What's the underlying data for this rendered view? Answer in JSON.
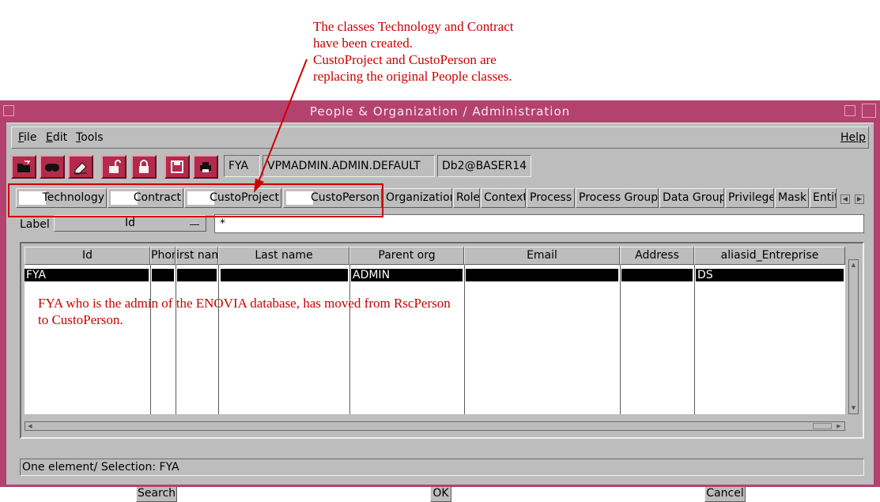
{
  "annotations": {
    "top_note": "The classes Technology and Contract\nhave been created.\nCustoProject and CustoPerson are\nreplacing the original People classes.",
    "bottom_note": "FYA who is the admin of the ENOVIA database, has moved from RscPerson\nto CustoPerson."
  },
  "window": {
    "title": "People & Organization / Administration"
  },
  "menu": {
    "file": "ile",
    "file_mn": "F",
    "edit": "dit",
    "edit_mn": "E",
    "tools": "ools",
    "tools_mn": "T",
    "help": "Help"
  },
  "toolbar": {
    "user": "FYA",
    "context": "VPMADMIN.ADMIN.DEFAULT",
    "database": "Db2@BASER14"
  },
  "tabs": {
    "technology": "Technology",
    "contract": "Contract",
    "custoproject": "CustoProject",
    "custoperson": "CustoPerson",
    "organization": "Organization",
    "role": "Role",
    "context": "Context",
    "process": "Process",
    "process_group": "Process Group",
    "data_group": "Data Group",
    "privilege": "Privilege",
    "mask": "Mask",
    "entity": "Entity"
  },
  "filter": {
    "label": "Label",
    "field": "Id",
    "value": "*"
  },
  "table": {
    "headers": {
      "id": "Id",
      "phone": "Phon",
      "first_name": "irst nam",
      "last_name": "Last name",
      "parent_org": "Parent org",
      "email": "Email",
      "address": "Address",
      "alias": "aliasid_Entreprise"
    },
    "row": {
      "id": "FYA",
      "parent_org": "ADMIN",
      "alias": "DS"
    }
  },
  "status": "One element/ Selection: FYA",
  "buttons": {
    "search": "Search",
    "ok": "OK",
    "cancel": "Cancel"
  },
  "colors": {
    "window_frame": "#b4426f",
    "accent_red": "#cc0000",
    "panel_gray": "#bdbdbd"
  }
}
